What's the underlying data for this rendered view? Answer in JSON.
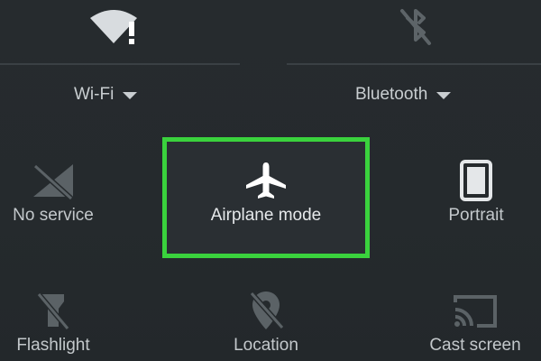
{
  "quick_settings": {
    "wifi": {
      "label": "Wi-Fi",
      "icon": "wifi-no-internet-icon"
    },
    "bluetooth": {
      "label": "Bluetooth",
      "icon": "bluetooth-off-icon"
    },
    "tiles_row1": [
      {
        "label": "No service",
        "icon": "no-signal-icon"
      },
      {
        "label": "Airplane mode",
        "icon": "airplane-icon",
        "highlighted": true
      },
      {
        "label": "Portrait",
        "icon": "portrait-icon"
      }
    ],
    "tiles_row2": [
      {
        "label": "Flashlight",
        "icon": "flashlight-off-icon"
      },
      {
        "label": "Location",
        "icon": "location-off-icon"
      },
      {
        "label": "Cast screen",
        "icon": "cast-icon"
      }
    ]
  },
  "colors": {
    "background": "#252a2d",
    "highlight": "#3ad23d",
    "text": "#c3c8cb"
  }
}
